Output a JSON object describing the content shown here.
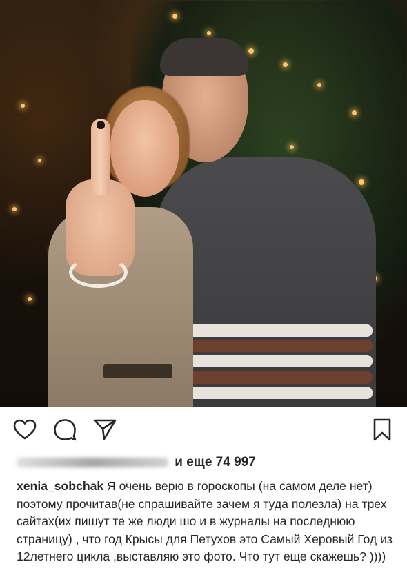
{
  "post": {
    "likes_text": "и еще 74 997",
    "username": "xenia_sobchak",
    "caption_text": "Я очень верю в гороскопы (на самом деле нет) поэтому прочитав(не спрашивайте зачем я туда полезла) на трех сайтах(их пишут те же люди шо и в журналы на последнюю страницу) ,  что год Крысы для Петухов это Самый Херовый Год из 12летнего цикла ,выставляю это фото. Что тут еще скажешь? ))))"
  },
  "icons": {
    "like": "heart-icon",
    "comment": "comment-bubble-icon",
    "share": "paper-plane-icon",
    "save": "bookmark-icon"
  },
  "colors": {
    "text": "#262626",
    "background": "#ffffff"
  }
}
